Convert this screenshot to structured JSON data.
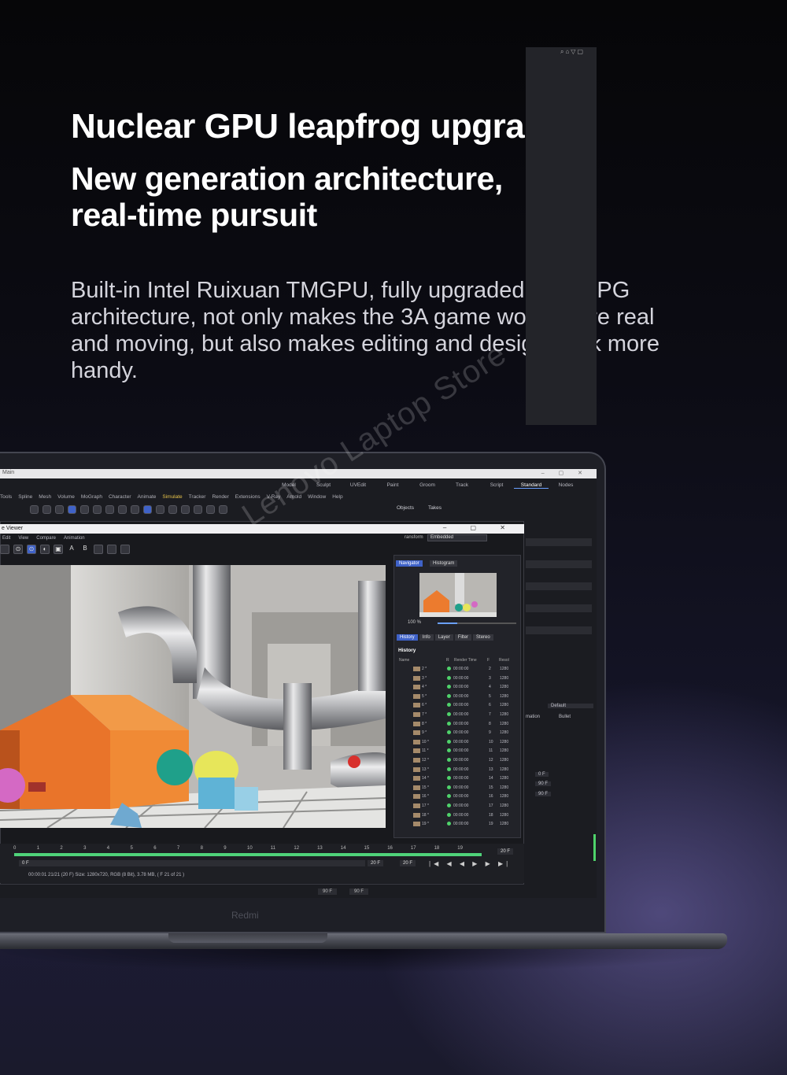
{
  "hero": {
    "headline": "Nuclear GPU leapfrog upgrade",
    "subhead": "New generation architecture, real-time pursuit",
    "body": "Built-in Intel Ruixuan TMGPU, fully upgraded to XeLPG architecture, not only makes the 3A game world more real and moving, but also makes editing and design work more handy."
  },
  "watermark": "Lenovo Laptop Store",
  "laptop": {
    "brand": "Redmi"
  },
  "app": {
    "title": "Main",
    "window_controls": "– ▢ ✕",
    "layout_tabs": [
      "Model",
      "Sculpt",
      "UVEdit",
      "Paint",
      "Groom",
      "Track",
      "Script",
      "Standard",
      "Nodes"
    ],
    "active_layout": "Standard",
    "menu": [
      "Tools",
      "Spline",
      "Mesh",
      "Volume",
      "MoGraph",
      "Character",
      "Animate",
      "Simulate",
      "Tracker",
      "Render",
      "Extensions",
      "V-Ray",
      "Arnold",
      "Window",
      "Help"
    ],
    "active_menu": "Simulate",
    "object_tabs": [
      "Objects",
      "Takes"
    ],
    "right_panel": {
      "default_label": "Default",
      "animation_label": "mation",
      "bullet_label": "Bullet",
      "frame_values": [
        "0 F",
        "90 F",
        "90 F"
      ]
    }
  },
  "viewer": {
    "title": "e Viewer",
    "controls": "– ▢ ✕",
    "menu": [
      "Edit",
      "View",
      "Compare",
      "Animation"
    ],
    "tool_letters": [
      "A",
      "B"
    ],
    "transform_label": "ransform",
    "embedded_value": "Embedded",
    "nav_tabs": [
      "Navigator",
      "Histogram"
    ],
    "zoom": "100 %",
    "zoom_fraction": 0.25,
    "history_tabs": [
      "History",
      "Info",
      "Layer",
      "Filter",
      "Stereo"
    ],
    "history_heading": "History",
    "history_columns": [
      "Name",
      "R",
      "Render Time",
      "F",
      "Resol"
    ],
    "history_rows": [
      {
        "name": "2 *",
        "time": "00:00:00",
        "frame": "2",
        "res": "1280"
      },
      {
        "name": "3 *",
        "time": "00:00:00",
        "frame": "3",
        "res": "1280"
      },
      {
        "name": "4 *",
        "time": "00:00:00",
        "frame": "4",
        "res": "1280"
      },
      {
        "name": "5 *",
        "time": "00:00:00",
        "frame": "5",
        "res": "1280"
      },
      {
        "name": "6 *",
        "time": "00:00:00",
        "frame": "6",
        "res": "1280"
      },
      {
        "name": "7 *",
        "time": "00:00:00",
        "frame": "7",
        "res": "1280"
      },
      {
        "name": "8 *",
        "time": "00:00:00",
        "frame": "8",
        "res": "1280"
      },
      {
        "name": "9 *",
        "time": "00:00:00",
        "frame": "9",
        "res": "1280"
      },
      {
        "name": "10 *",
        "time": "00:00:00",
        "frame": "10",
        "res": "1280"
      },
      {
        "name": "11 *",
        "time": "00:00:00",
        "frame": "11",
        "res": "1280"
      },
      {
        "name": "12 *",
        "time": "00:00:00",
        "frame": "12",
        "res": "1280"
      },
      {
        "name": "13 *",
        "time": "00:00:00",
        "frame": "13",
        "res": "1280"
      },
      {
        "name": "14 *",
        "time": "00:00:00",
        "frame": "14",
        "res": "1280"
      },
      {
        "name": "15 *",
        "time": "00:00:00",
        "frame": "15",
        "res": "1280"
      },
      {
        "name": "16 *",
        "time": "00:00:00",
        "frame": "16",
        "res": "1280"
      },
      {
        "name": "17 *",
        "time": "00:00:00",
        "frame": "17",
        "res": "1280"
      },
      {
        "name": "18 *",
        "time": "00:00:00",
        "frame": "18",
        "res": "1280"
      },
      {
        "name": "19 *",
        "time": "00:00:00",
        "frame": "19",
        "res": "1280"
      }
    ],
    "timeline": {
      "ticks": [
        "0",
        "1",
        "2",
        "3",
        "4",
        "5",
        "6",
        "7",
        "8",
        "9",
        "10",
        "11",
        "12",
        "13",
        "14",
        "15",
        "16",
        "17",
        "18",
        "19"
      ],
      "progress": 1.0,
      "end_frame": "20 F",
      "start_frame": "0 F",
      "field_a": "20 F",
      "field_b": "20 F",
      "transport": "|◀ ◀ ◀ ▶ ▶ ▶|",
      "status": "00:00:01 21/21 (20 F)    Size: 1280x720, RGB (8 Bit), 3.78 MB,  ( F 21 of 21 )",
      "bottom_a": "90 F",
      "bottom_b": "90 F"
    }
  },
  "colors": {
    "accent": "#3f62c8",
    "status_green": "#4fd36b",
    "menu_highlight": "#e6c24a"
  }
}
